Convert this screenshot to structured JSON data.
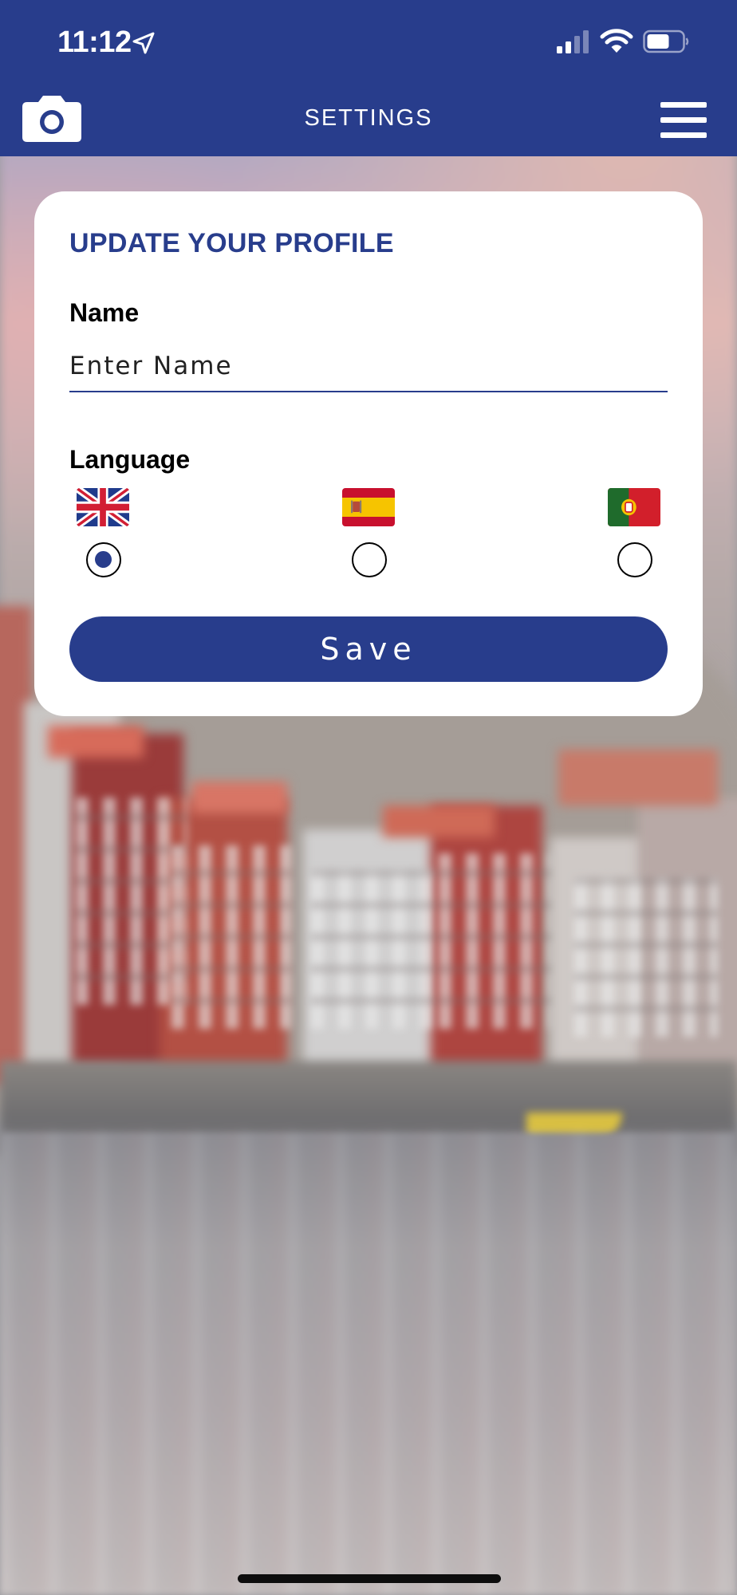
{
  "status_bar": {
    "time": "11:12",
    "icons": [
      "location-arrow-icon",
      "cellular-signal-icon",
      "wifi-icon",
      "battery-icon"
    ]
  },
  "header": {
    "title": "SETTINGS",
    "left_icon": "camera-icon",
    "right_icon": "hamburger-menu-icon",
    "background_color": "#283d8c"
  },
  "profile_card": {
    "title": "UPDATE YOUR PROFILE",
    "name": {
      "label": "Name",
      "value": "",
      "placeholder": "Enter Name"
    },
    "language": {
      "label": "Language",
      "options": [
        {
          "flag": "united-kingdom-flag-icon",
          "selected": true
        },
        {
          "flag": "spain-flag-icon",
          "selected": false
        },
        {
          "flag": "portugal-flag-icon",
          "selected": false
        }
      ]
    },
    "save_label": "Save"
  },
  "colors": {
    "accent": "#283d8c",
    "card_background": "#ffffff"
  }
}
